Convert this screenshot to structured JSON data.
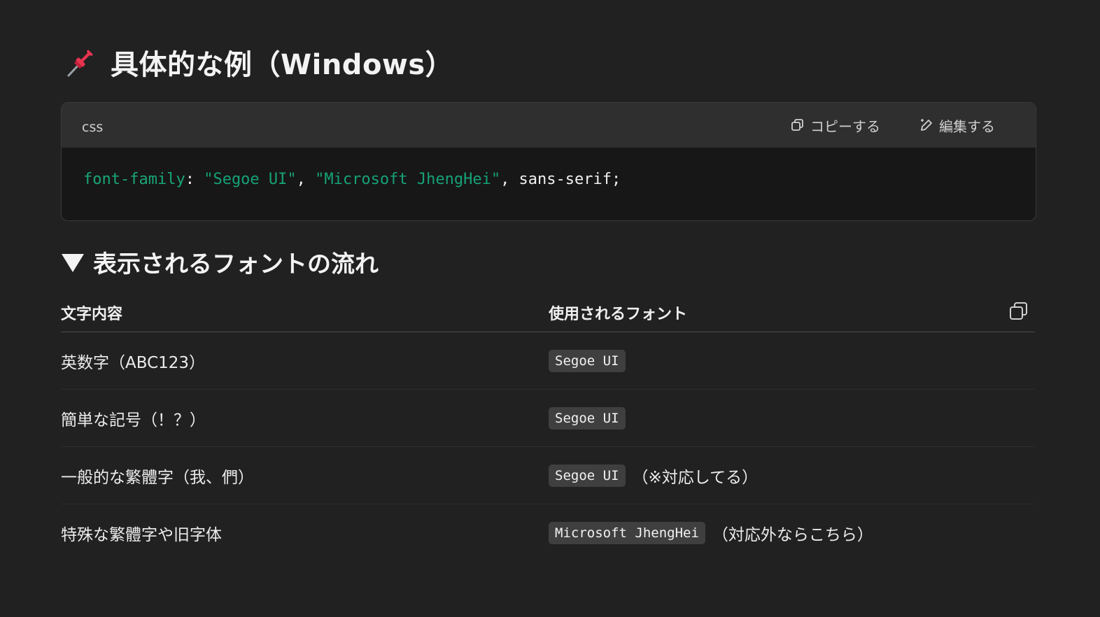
{
  "heading": {
    "icon": "pushpin-icon",
    "title": "具体的な例（Windows）"
  },
  "code_block": {
    "language": "css",
    "copy_label": "コピーする",
    "edit_label": "編集する",
    "code": {
      "prop": "font-family",
      "colon": ": ",
      "str1": "\"Segoe UI\"",
      "comma1": ", ",
      "str2": "\"Microsoft JhengHei\"",
      "rest": ", sans-serif;"
    }
  },
  "subheading": {
    "icon": "triangle-down-icon",
    "title": "表示されるフォントの流れ"
  },
  "table": {
    "headers": [
      "文字内容",
      "使用されるフォント"
    ],
    "rows": [
      {
        "content": "英数字（ABC123）",
        "font": "Segoe UI",
        "note": ""
      },
      {
        "content": "簡単な記号（！？）",
        "font": "Segoe UI",
        "note": ""
      },
      {
        "content": "一般的な繁體字（我、們）",
        "font": "Segoe UI",
        "note": "（※対応してる）"
      },
      {
        "content": "特殊な繁體字や旧字体",
        "font": "Microsoft JhengHei",
        "note": "（対応外ならこちら）"
      }
    ]
  },
  "colors": {
    "background": "#212121",
    "code_header": "#2f2f2f",
    "code_body": "#171717",
    "token_green": "#19a777",
    "badge": "#3f3f3f"
  }
}
